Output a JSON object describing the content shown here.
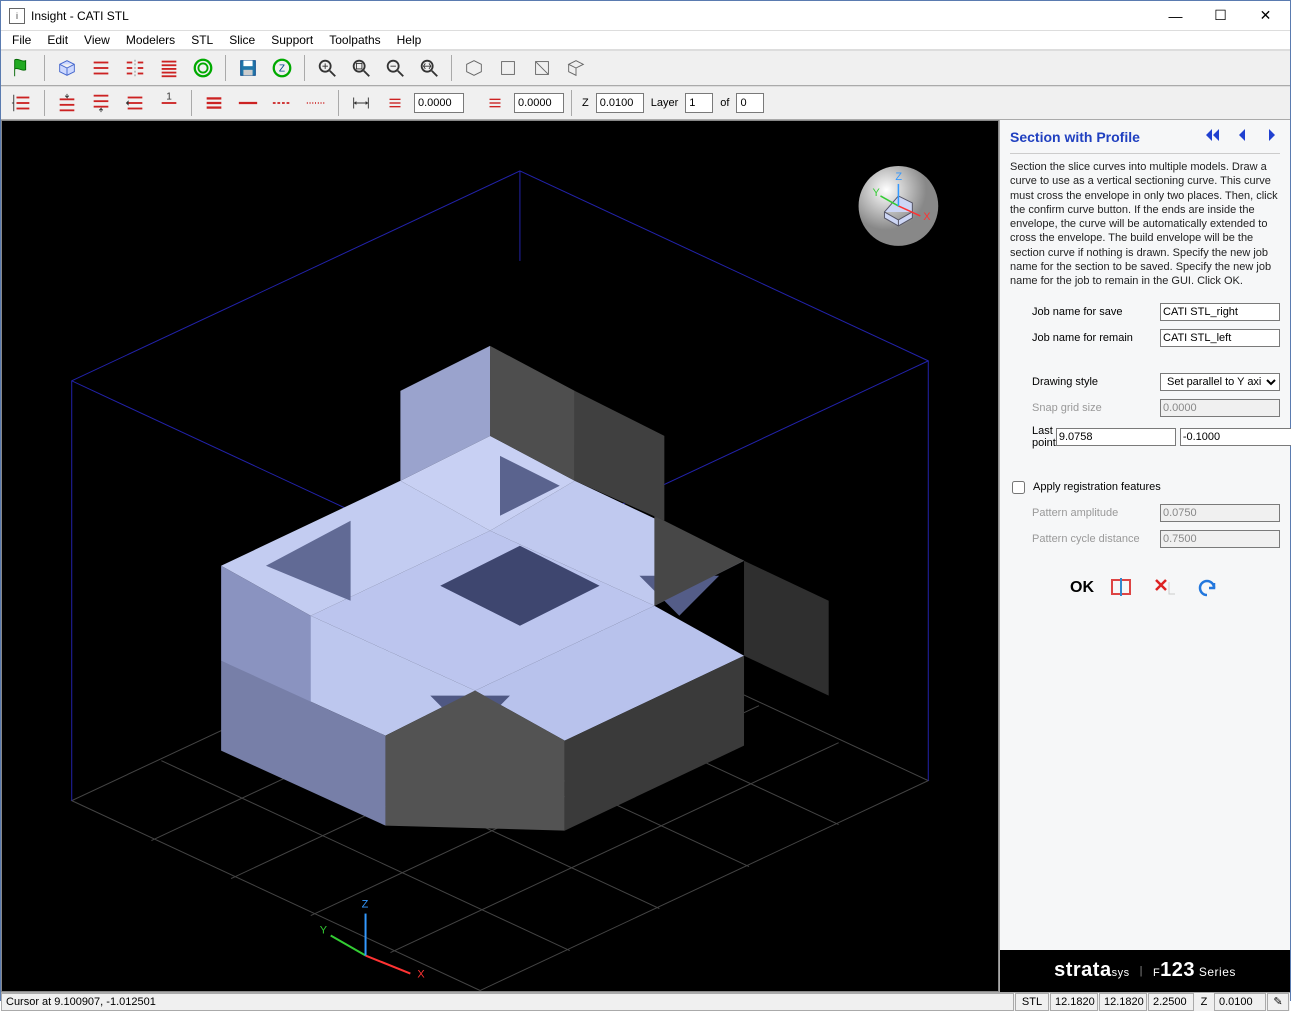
{
  "window": {
    "title": "Insight - CATI STL"
  },
  "menu": [
    "File",
    "Edit",
    "View",
    "Modelers",
    "STL",
    "Slice",
    "Support",
    "Toolpaths",
    "Help"
  ],
  "toolbar2": {
    "v1": "0.0000",
    "v2": "0.0000",
    "z_label": "Z",
    "z_val": "0.0100",
    "layer_label": "Layer",
    "layer_cur": "1",
    "layer_of": "of",
    "layer_tot": "0"
  },
  "panel": {
    "title": "Section with Profile",
    "instructions": "Section the slice curves into multiple models. Draw a curve to use as a vertical sectioning curve. This curve must cross the envelope in only two places. Then, click the confirm curve button. If the ends are inside the envelope, the curve will be automatically extended to cross the envelope. The build envelope will be the section curve if nothing is drawn. Specify the new job name for the section to be saved. Specify the new job name for the job to remain in the GUI. Click OK.",
    "job_save_label": "Job name for save",
    "job_save_val": "CATI STL_right",
    "job_remain_label": "Job name for remain",
    "job_remain_val": "CATI STL_left",
    "drawing_label": "Drawing style",
    "drawing_val": "Set parallel to Y axis",
    "snap_label": "Snap grid size",
    "snap_val": "0.0000",
    "lastpoint_label": "Last point",
    "lastpoint_x": "9.0758",
    "lastpoint_y": "-0.1000",
    "apply_reg_label": "Apply registration features",
    "pattern_amp_label": "Pattern amplitude",
    "pattern_amp_val": "0.0750",
    "pattern_cyc_label": "Pattern cycle distance",
    "pattern_cyc_val": "0.7500",
    "ok": "OK"
  },
  "brand": {
    "name_a": "strata",
    "name_b": "sys",
    "series_pre": "F",
    "series_num": "123",
    "series_suf": " Series"
  },
  "status": {
    "cursor": "Cursor at 9.100907, -1.012501",
    "mode": "STL",
    "dim1": "12.1820",
    "dim2": "12.1820",
    "dim3": "2.2500",
    "zlabel": "Z",
    "zval": "0.0100"
  }
}
